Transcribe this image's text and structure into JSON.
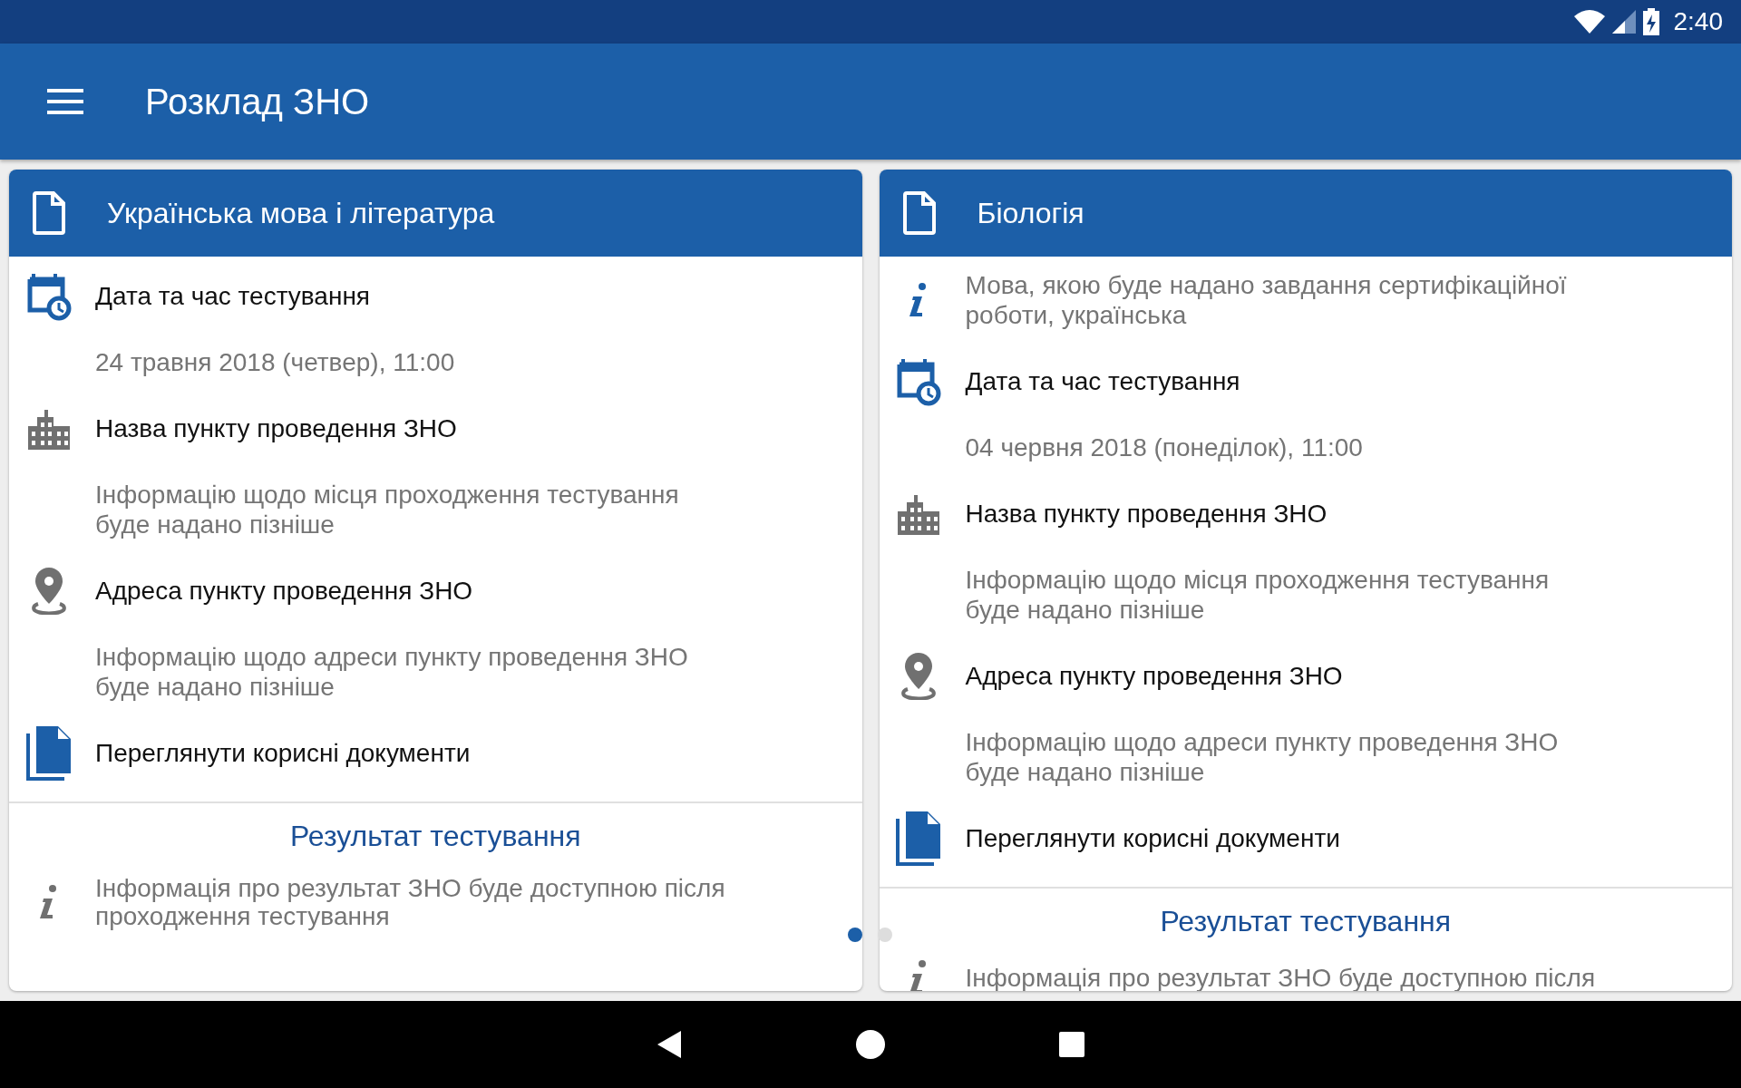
{
  "status_bar": {
    "time": "2:40"
  },
  "app_bar": {
    "title": "Розклад ЗНО"
  },
  "cards": [
    {
      "title": "Українська мова і література",
      "sections": [
        {
          "kind": "date",
          "title": "Дата та час тестування",
          "detail": "24 травня 2018 (четвер), 11:00"
        },
        {
          "kind": "place",
          "title": "Назва пункту проведення ЗНО",
          "detail": "Інформацію щодо місця проходження тестування\nбуде надано пізніше"
        },
        {
          "kind": "address",
          "title": "Адреса пункту проведення ЗНО",
          "detail": "Інформацію щодо адреси пункту проведення ЗНО\nбуде надано пізніше"
        },
        {
          "kind": "documents",
          "title": "Переглянути корисні документи"
        }
      ],
      "result": {
        "title": "Результат тестування",
        "text": "Інформація про результат ЗНО буде доступною після\nпроходження тестування"
      }
    },
    {
      "title": "Біологія",
      "sections": [
        {
          "kind": "language",
          "detail": "Мова, якою буде надано завдання сертифікаційної\nроботи, українська"
        },
        {
          "kind": "date",
          "title": "Дата та час тестування",
          "detail": "04 червня 2018 (понеділок), 11:00"
        },
        {
          "kind": "place",
          "title": "Назва пункту проведення ЗНО",
          "detail": "Інформацію щодо місця проходження тестування\nбуде надано пізніше"
        },
        {
          "kind": "address",
          "title": "Адреса пункту проведення ЗНО",
          "detail": "Інформацію щодо адреси пункту проведення ЗНО\nбуде надано пізніше"
        },
        {
          "kind": "documents",
          "title": "Переглянути корисні документи"
        }
      ],
      "result": {
        "title": "Результат тестування",
        "text": "Інформація про результат ЗНО буде доступною після"
      }
    }
  ],
  "page_indicator": [
    {
      "selected": true
    },
    {
      "selected": false
    }
  ]
}
